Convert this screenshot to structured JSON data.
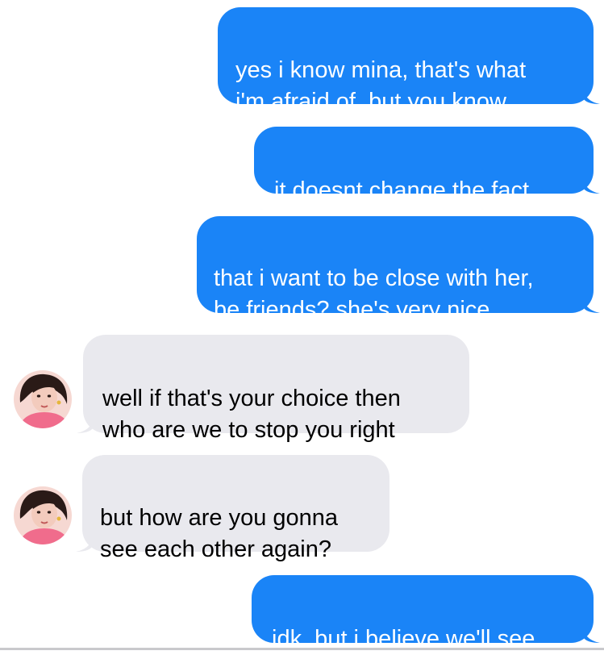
{
  "messages": [
    {
      "direction": "outgoing",
      "text": "yes i know mina, that's what\ni'm afraid of, but you know"
    },
    {
      "direction": "outgoing",
      "text": "it doesnt change the fact"
    },
    {
      "direction": "outgoing",
      "text": "that i want to be close with her,\nbe friends? she's very nice"
    },
    {
      "direction": "incoming",
      "text": "well if that's your choice then\nwho are we to stop you right"
    },
    {
      "direction": "incoming",
      "text": "but how are you gonna\nsee each other again?"
    },
    {
      "direction": "outgoing",
      "text": "idk, but i believe we'll see"
    }
  ],
  "colors": {
    "outgoing_bubble": "#1a84f7",
    "incoming_bubble": "#e9e9ee"
  },
  "icons": {
    "avatar": "contact-avatar-photo"
  }
}
